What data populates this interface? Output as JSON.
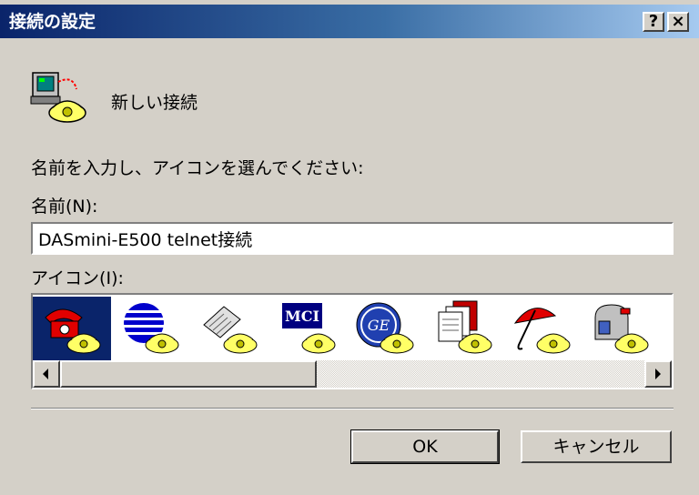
{
  "window": {
    "title": "接続の設定",
    "help_label": "?",
    "close_label": "×"
  },
  "connection": {
    "name_display": "新しい接続"
  },
  "form": {
    "instruction": "名前を入力し、アイコンを選んでください:",
    "name_label": "名前(N):",
    "name_value": "DASmini-E500 telnet接続",
    "icon_label": "アイコン(I):"
  },
  "icons": [
    {
      "name": "red-telephone-icon",
      "selected": true
    },
    {
      "name": "blue-globe-stripes-icon",
      "selected": false
    },
    {
      "name": "fax-machine-icon",
      "selected": false
    },
    {
      "name": "mci-logo-icon",
      "selected": false
    },
    {
      "name": "ge-logo-icon",
      "selected": false
    },
    {
      "name": "documents-icon",
      "selected": false
    },
    {
      "name": "red-umbrella-icon",
      "selected": false
    },
    {
      "name": "mailbox-icon",
      "selected": false
    }
  ],
  "icon_text": {
    "mci": "MCI",
    "ge": "GE"
  },
  "buttons": {
    "ok": "OK",
    "cancel": "キャンセル"
  },
  "colors": {
    "titlebar_start": "#0a246a",
    "titlebar_end": "#a6caf0",
    "selection": "#0a246a",
    "face": "#d4d0c8"
  }
}
